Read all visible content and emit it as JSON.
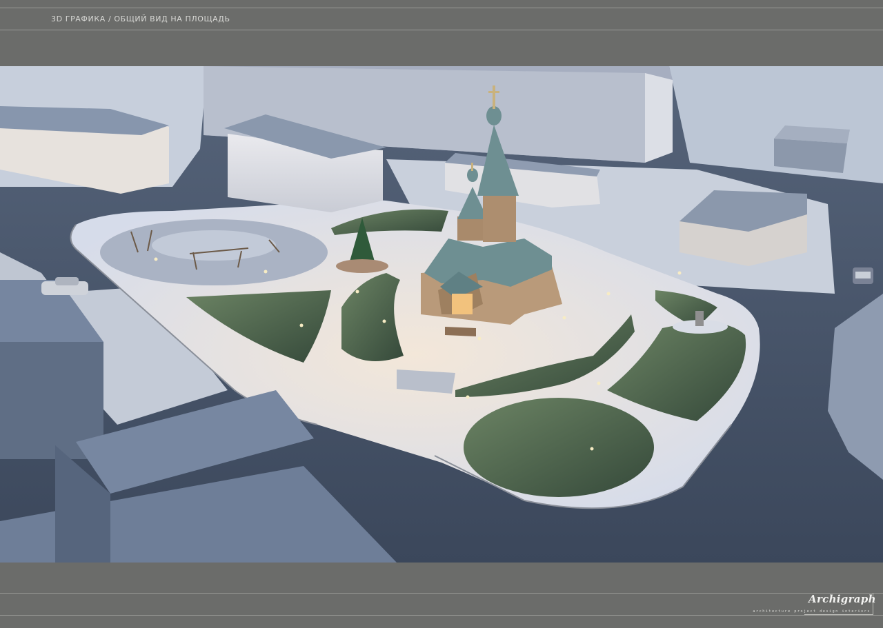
{
  "header": {
    "title": "3D ГРАФИКА / ОБЩИЙ ВИД НА ПЛОЩАДЬ"
  },
  "footer": {
    "logo_text": "Archigraph",
    "logo_tagline": "architecture  project  design  interiors"
  },
  "scene": {
    "subject": "aerial-render-square-with-wooden-church",
    "colors": {
      "ground_snow": "#e9edf3",
      "road": "#4d5a6e",
      "church_wood": "#b99a7a",
      "church_roof": "#6e8f92",
      "greenery": "#4f6a4a",
      "building_white": "#e5e6ea",
      "building_shadow": "#7c8aa1"
    }
  }
}
